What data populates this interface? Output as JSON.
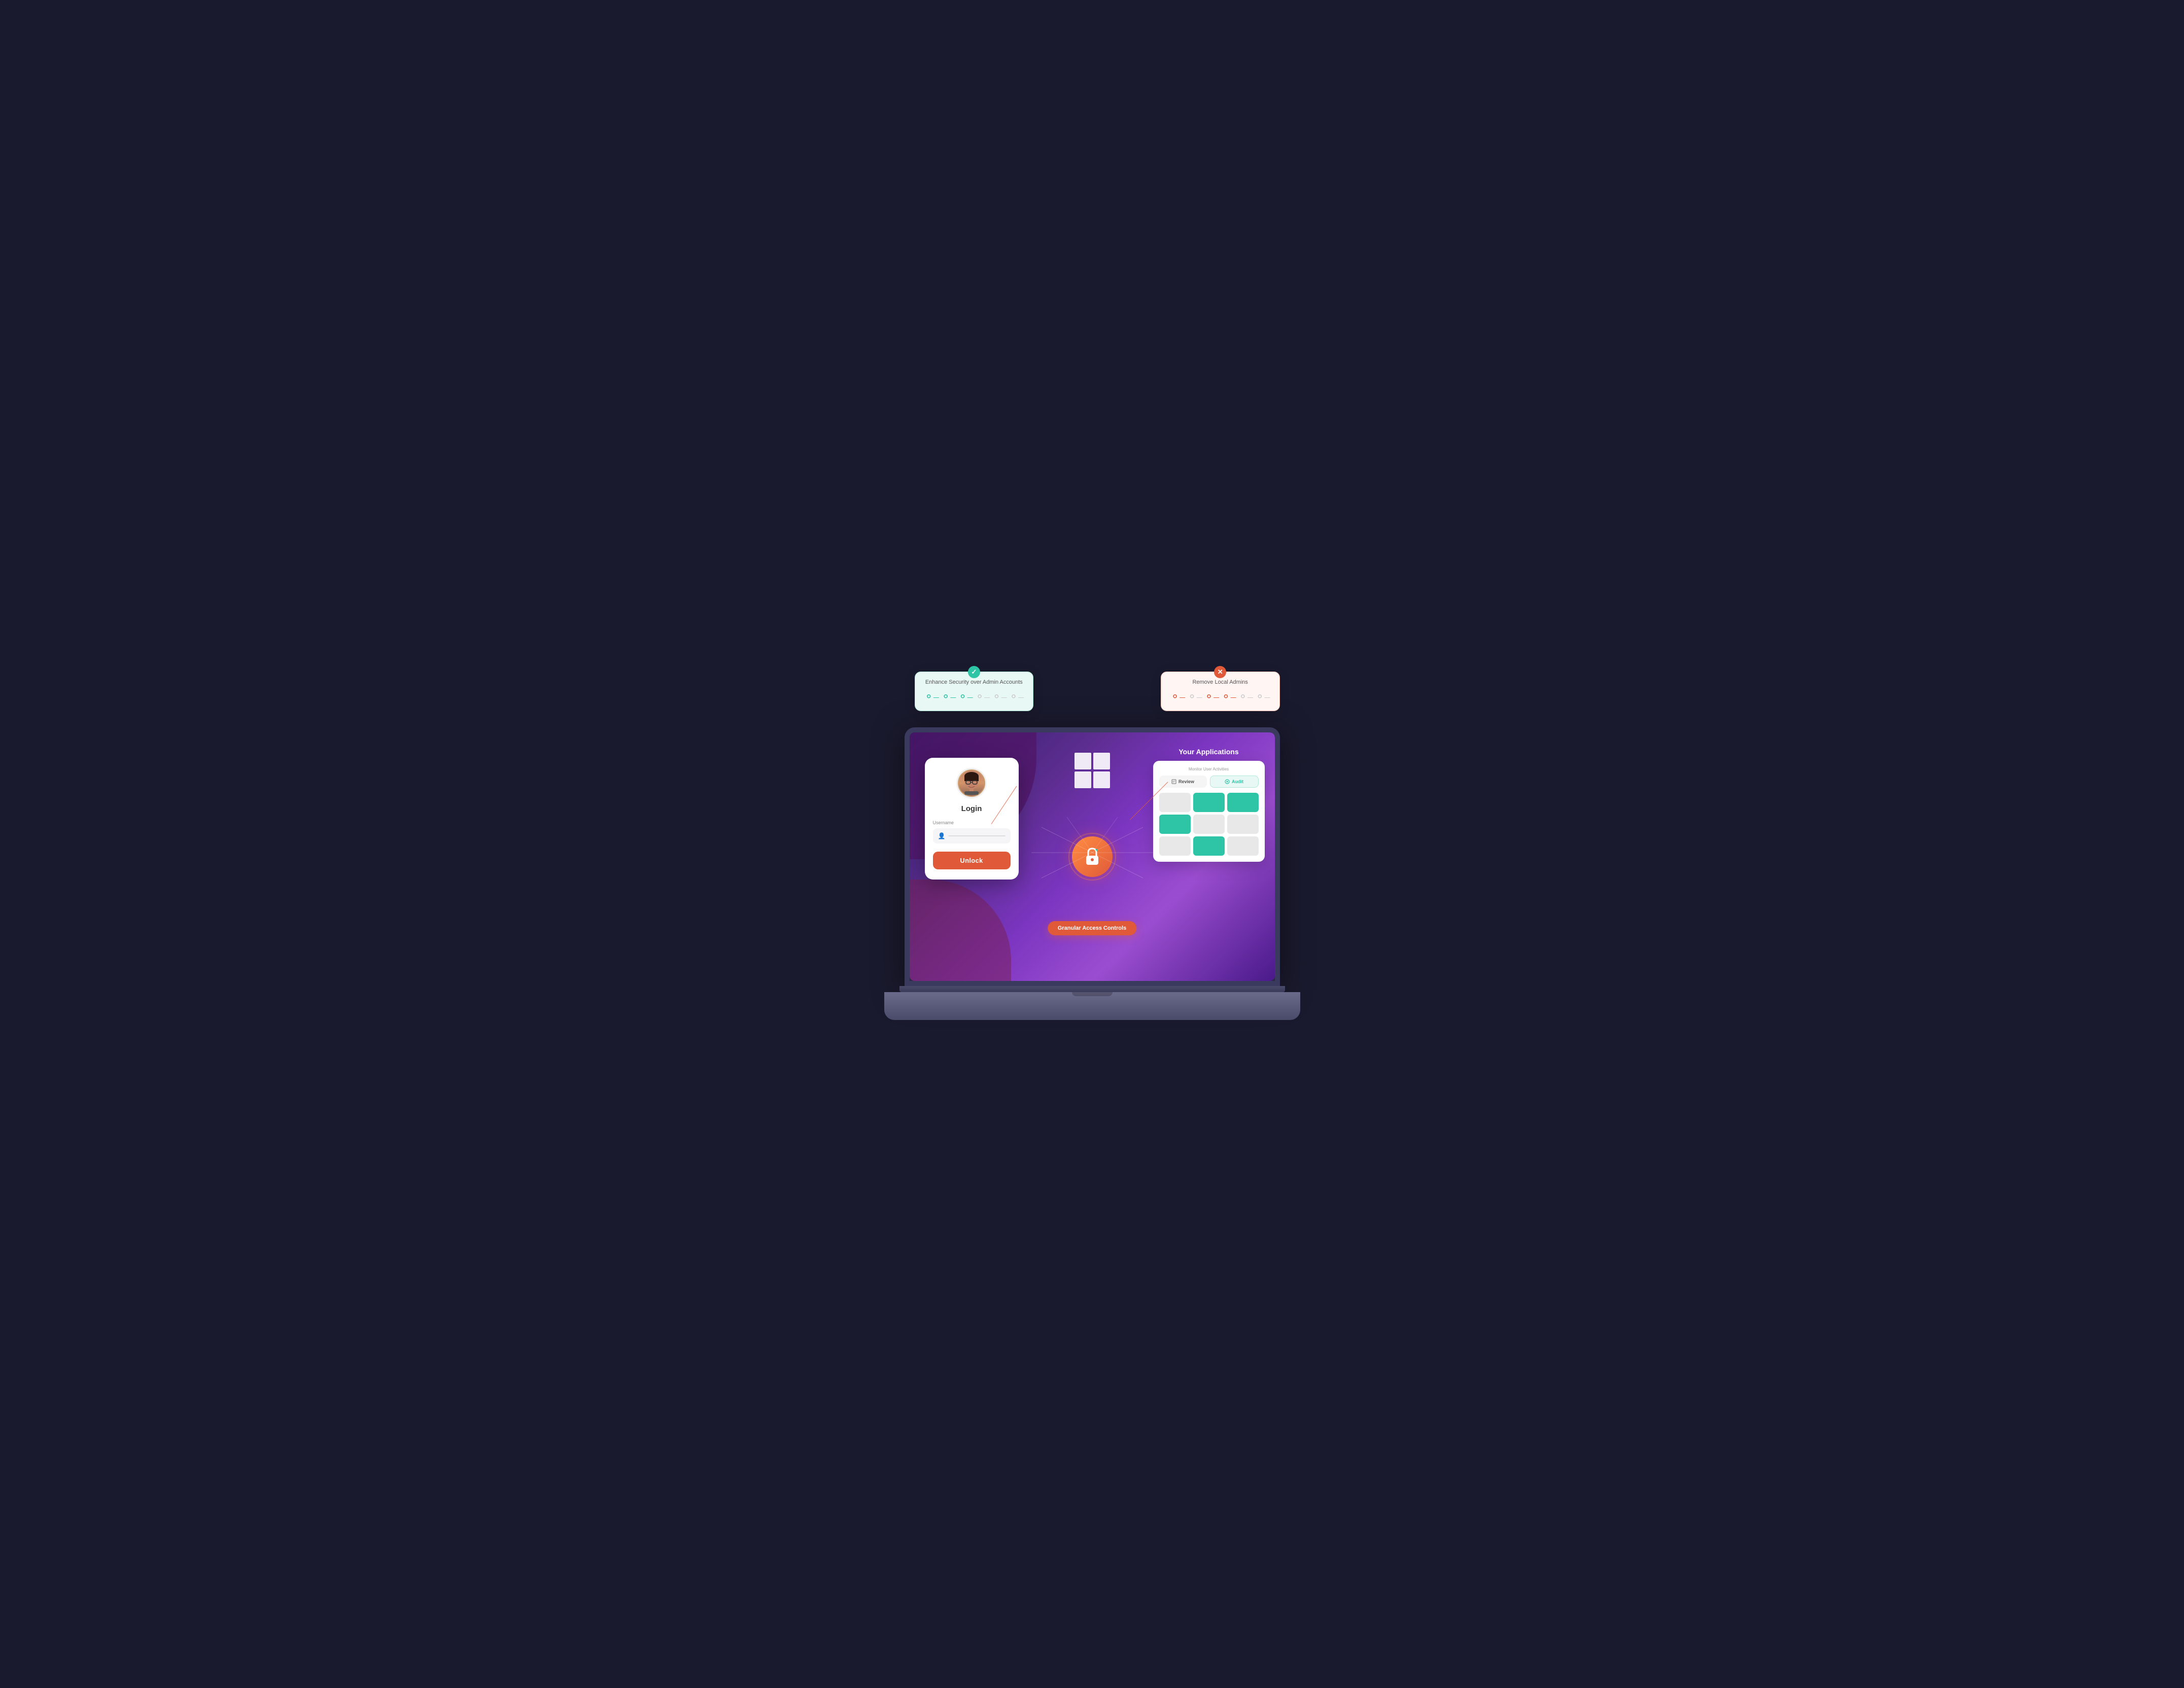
{
  "scene": {
    "background": "#1a1a2e"
  },
  "callout_left": {
    "title": "Enhance Security over Admin Accounts",
    "badge": "✓",
    "badge_color": "#2ec4a6",
    "people": [
      "teal",
      "teal",
      "teal",
      "light",
      "light",
      "light"
    ],
    "background": "#e8f8f4"
  },
  "callout_right": {
    "title": "Remove Local Admins",
    "badge": "✕",
    "badge_color": "#e05a3a",
    "people": [
      "orange",
      "light",
      "orange",
      "orange",
      "light",
      "light"
    ],
    "background": "#fff5f3"
  },
  "login_card": {
    "avatar_emoji": "👩",
    "title": "Login",
    "username_label": "Username",
    "unlock_button": "Unlock"
  },
  "center": {
    "lock_icon": "🔒",
    "granular_label": "Granular Access Controls"
  },
  "apps_panel": {
    "title": "Your Applications",
    "monitor_label": "Monitor User Activities",
    "tab_review": "Review",
    "tab_audit": "Audit",
    "grid": [
      "gray",
      "teal",
      "teal",
      "teal",
      "gray",
      "gray",
      "gray",
      "teal",
      "gray"
    ]
  }
}
